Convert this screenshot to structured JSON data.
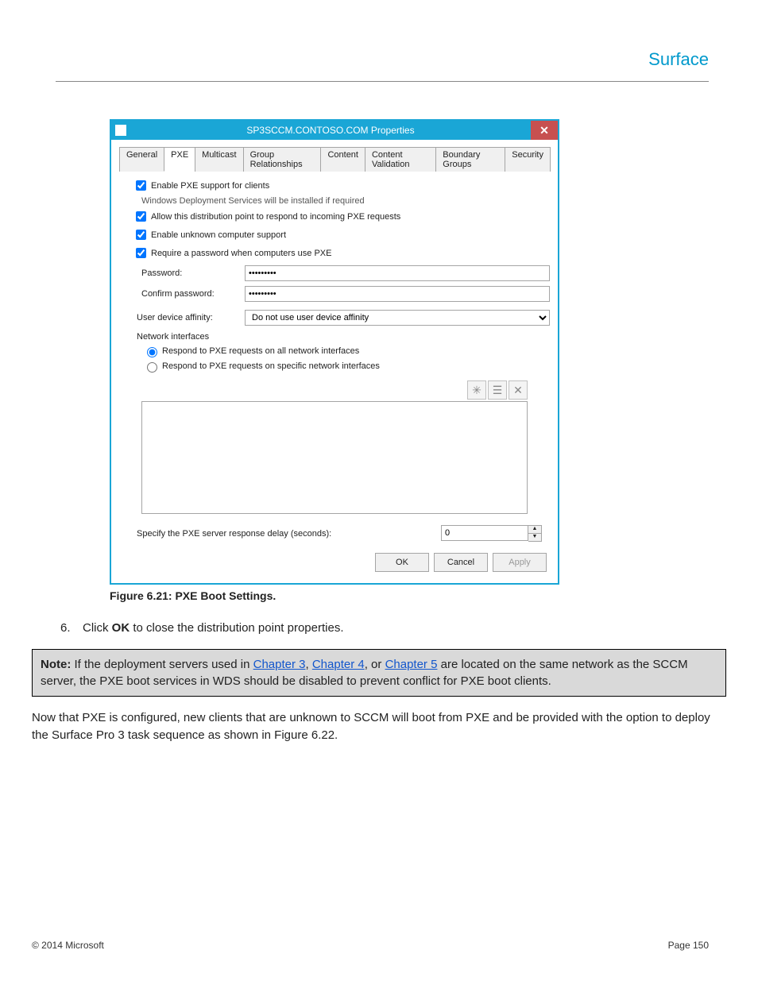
{
  "brand": "Surface",
  "dialog": {
    "title": "SP3SCCM.CONTOSO.COM Properties",
    "tabs": [
      "General",
      "PXE",
      "Multicast",
      "Group Relationships",
      "Content",
      "Content Validation",
      "Boundary Groups",
      "Security"
    ],
    "active_tab": 1,
    "cb_enable_pxe": "Enable PXE support for clients",
    "wds_note": "Windows Deployment Services will be installed if required",
    "cb_allow_incoming": "Allow this distribution point to respond to incoming PXE requests",
    "cb_enable_unknown": "Enable unknown computer support",
    "cb_require_pw": "Require a password when computers use PXE",
    "password_label": "Password:",
    "password_value": "•••••••••",
    "confirm_label": "Confirm password:",
    "confirm_value": "•••••••••",
    "affinity_label": "User device affinity:",
    "affinity_value": "Do not use user device affinity",
    "ni_group": "Network interfaces",
    "ni_all": "Respond to PXE requests on all network interfaces",
    "ni_specific": "Respond to PXE requests on specific network interfaces",
    "delay_label": "Specify the PXE server response delay (seconds):",
    "delay_value": "0",
    "btn_ok": "OK",
    "btn_cancel": "Cancel",
    "btn_apply": "Apply"
  },
  "caption_prefix": "Figure 6.21: ",
  "caption_text": "PXE Boot Settings.",
  "step_num": "6.",
  "step_text_a": "Click ",
  "step_bold": "OK",
  "step_text_b": " to close the distribution point properties.",
  "note_bold": "Note:",
  "note_a": " If the deployment servers used in ",
  "note_link1": "Chapter 3",
  "note_b": ", ",
  "note_link2": "Chapter 4",
  "note_c": ", or ",
  "note_link3": "Chapter 5",
  "note_d": " are located on the same network as the SCCM server, the PXE boot services in WDS should be disabled to prevent conflict for PXE boot clients.",
  "para": "Now that PXE is configured, new clients that are unknown to SCCM will boot from PXE and be provided with the option to deploy the Surface Pro 3 task sequence as shown in Figure 6.22.",
  "footer_left": "© 2014 Microsoft",
  "footer_right": "Page 150"
}
